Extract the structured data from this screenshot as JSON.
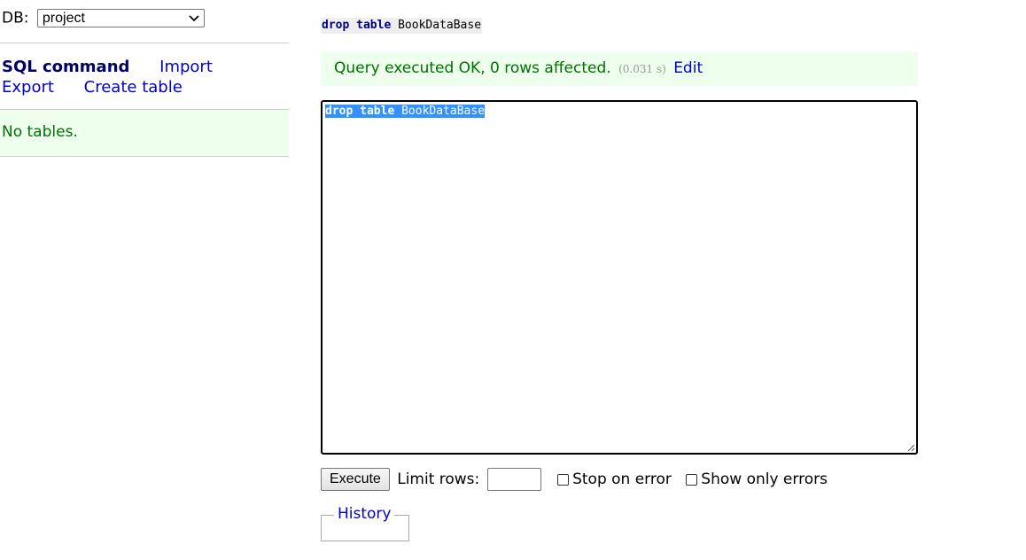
{
  "sidebar": {
    "db_label": "DB:",
    "db_selected": "project",
    "menu": {
      "sql_command": "SQL command",
      "import": "Import",
      "export": "Export",
      "create_table": "Create table"
    },
    "no_tables": "No tables."
  },
  "content": {
    "query_echo": {
      "kw1": "drop",
      "kw2": "table",
      "ident": "BookDataBase"
    },
    "message": {
      "text": "Query executed OK, 0 rows affected.",
      "time": "(0.031 s)",
      "edit_link": "Edit"
    },
    "editor": {
      "kw1": "drop",
      "kw2": "table",
      "ident": "BookDataBase"
    },
    "controls": {
      "execute": "Execute",
      "limit_rows_label": "Limit rows:",
      "limit_rows_value": "",
      "stop_on_error_label": "Stop on error",
      "stop_on_error_checked": false,
      "show_only_errors_label": "Show only errors",
      "show_only_errors_checked": false
    },
    "history": {
      "legend": "History"
    }
  },
  "colors": {
    "success_bg": "#eeffee",
    "success_text": "#007000",
    "link": "#0000cc",
    "selection": "#3390ff",
    "keyword": "#000080"
  },
  "icons": {
    "select_arrow": "chevron-down-icon",
    "resize": "resize-grip-icon"
  }
}
